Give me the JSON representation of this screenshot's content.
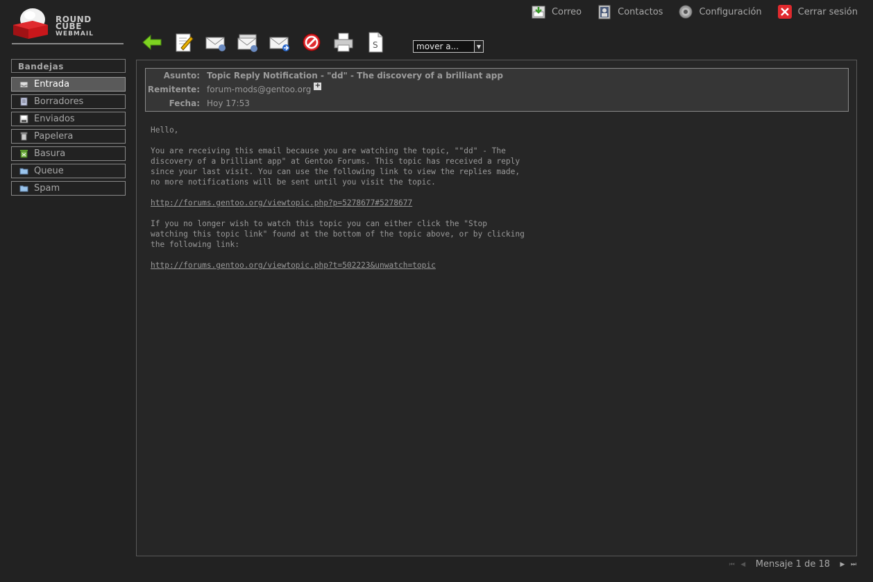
{
  "app": {
    "logo_line1": "ROUND",
    "logo_line2": "CUBE",
    "logo_line3": "WEBMAIL"
  },
  "topnav": [
    {
      "label": "Correo",
      "icon": "mail-icon"
    },
    {
      "label": "Contactos",
      "icon": "contacts-icon"
    },
    {
      "label": "Configuración",
      "icon": "gear-icon"
    },
    {
      "label": "Cerrar sesión",
      "icon": "logout-icon"
    }
  ],
  "toolbar": {
    "move_to": "mover a..."
  },
  "folders": {
    "header": "Bandejas",
    "items": [
      {
        "label": "Entrada",
        "icon": "inbox-icon",
        "selected": true
      },
      {
        "label": "Borradores",
        "icon": "drafts-icon"
      },
      {
        "label": "Enviados",
        "icon": "sent-icon"
      },
      {
        "label": "Papelera",
        "icon": "trash-icon"
      },
      {
        "label": "Basura",
        "icon": "junk-icon"
      },
      {
        "label": "Queue",
        "icon": "folder-icon"
      },
      {
        "label": "Spam",
        "icon": "folder-icon"
      }
    ]
  },
  "message": {
    "subject_label": "Asunto:",
    "subject": "Topic Reply Notification - \"dd\" - The discovery of a brilliant app",
    "from_label": "Remitente:",
    "from": "forum-mods@gentoo.org",
    "date_label": "Fecha:",
    "date": "Hoy 17:53",
    "body": {
      "greeting": "Hello,",
      "para1": "You are receiving this email because you are watching the topic, \"\"dd\" - The\ndiscovery of a brilliant app\" at Gentoo Forums. This topic has received a reply\nsince your last visit. You can use the following link to view the replies made,\nno more notifications will be sent until you visit the topic.",
      "link1": "http://forums.gentoo.org/viewtopic.php?p=5278677#5278677",
      "para2": "If you no longer wish to watch this topic you can either click the \"Stop\nwatching this topic link\" found at the bottom of the topic above, or by clicking\nthe following link:",
      "link2": "http://forums.gentoo.org/viewtopic.php?t=502223&unwatch=topic"
    }
  },
  "pager": {
    "text": "Mensaje 1 de 18"
  }
}
